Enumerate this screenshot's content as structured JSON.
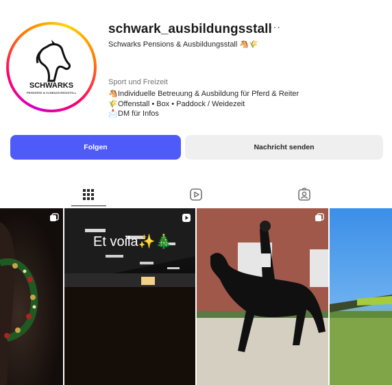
{
  "profile": {
    "username": "schwark_ausbildungsstall",
    "more_label": "···",
    "full_name": "Schwarks Pensions & Ausbildungsstall 🐴🌾",
    "category": "Sport und Freizeit",
    "bio": [
      {
        "icon": "🐴",
        "text": "Individuelle Betreuung & Ausbildung für Pferd & Reiter"
      },
      {
        "icon": "🌾",
        "text": "Offenstall • Box • Paddock / Weidezeit"
      },
      {
        "icon": "📩",
        "text": "DM für Infos"
      }
    ],
    "avatar_logo_text": "SCHWARKS",
    "avatar_logo_subtext": "PENSIONS & AUSBILDUNGSSTALL"
  },
  "actions": {
    "follow_label": "Folgen",
    "message_label": "Nachricht senden"
  },
  "tabs": [
    "grid-icon",
    "reels-icon",
    "tagged-icon"
  ],
  "posts": [
    {
      "type": "carousel",
      "caption_overlay": ""
    },
    {
      "type": "reel",
      "caption_overlay": "Et voila✨🎄"
    },
    {
      "type": "carousel",
      "caption_overlay": ""
    },
    {
      "type": "unknown",
      "caption_overlay": ""
    }
  ],
  "colors": {
    "follow_button": "#4f5bf8",
    "message_button": "#efefef",
    "text_primary": "#262626",
    "text_secondary": "#737373"
  }
}
